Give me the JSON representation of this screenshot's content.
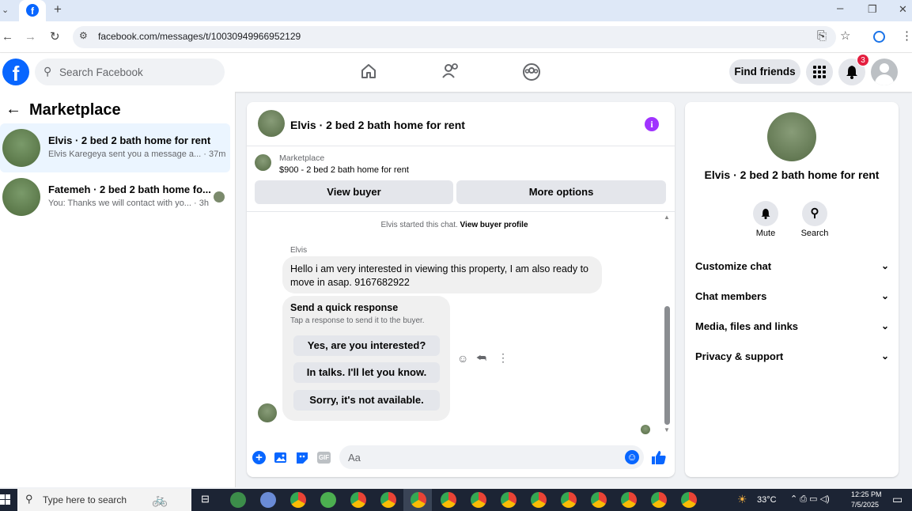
{
  "browser": {
    "url": "facebook.com/messages/t/10030949966952129",
    "new_tab": "+",
    "min": "–",
    "restore": "❐",
    "close": "✕"
  },
  "header": {
    "search_placeholder": "Search Facebook",
    "find_friends": "Find friends",
    "notif_count": "3"
  },
  "left": {
    "title": "Marketplace",
    "conversations": [
      {
        "name": "Elvis · 2 bed 2 bath home for rent",
        "preview": "Elvis Karegeya sent you a message a... · 37m"
      },
      {
        "name": "Fatemeh · 2 bed 2 bath home fo...",
        "preview": "You: Thanks we will contact with yo... · 3h"
      }
    ]
  },
  "chat": {
    "title": "Elvis · 2 bed 2 bath home for rent",
    "listing_label": "Marketplace",
    "listing_detail": "$900 - 2 bed 2 bath home for rent",
    "view_buyer": "View buyer",
    "more_options": "More options",
    "started_text": "Elvis started this chat.",
    "view_profile": "View buyer profile",
    "sender": "Elvis",
    "message": "Hello i am very interested in viewing this property, I am also ready to move in asap. 9167682922",
    "quick_title": "Send a quick response",
    "quick_sub": "Tap a response to send it to the buyer.",
    "quick_responses": [
      "Yes, are you interested?",
      "In talks. I'll let you know.",
      "Sorry, it's not available."
    ],
    "composer_placeholder": "Aa",
    "gif": "GIF"
  },
  "right": {
    "title": "Elvis · 2 bed 2 bath home for rent",
    "mute": "Mute",
    "search": "Search",
    "sections": [
      "Customize chat",
      "Chat members",
      "Media, files and links",
      "Privacy & support"
    ]
  },
  "taskbar": {
    "search": "Type here to search",
    "temp": "33°C",
    "time": "12:25 PM",
    "date": "7/5/2025"
  },
  "colors": {
    "fb_blue": "#0866ff",
    "messenger_purple": "#a033ff",
    "taskbar": "#1c2434"
  }
}
